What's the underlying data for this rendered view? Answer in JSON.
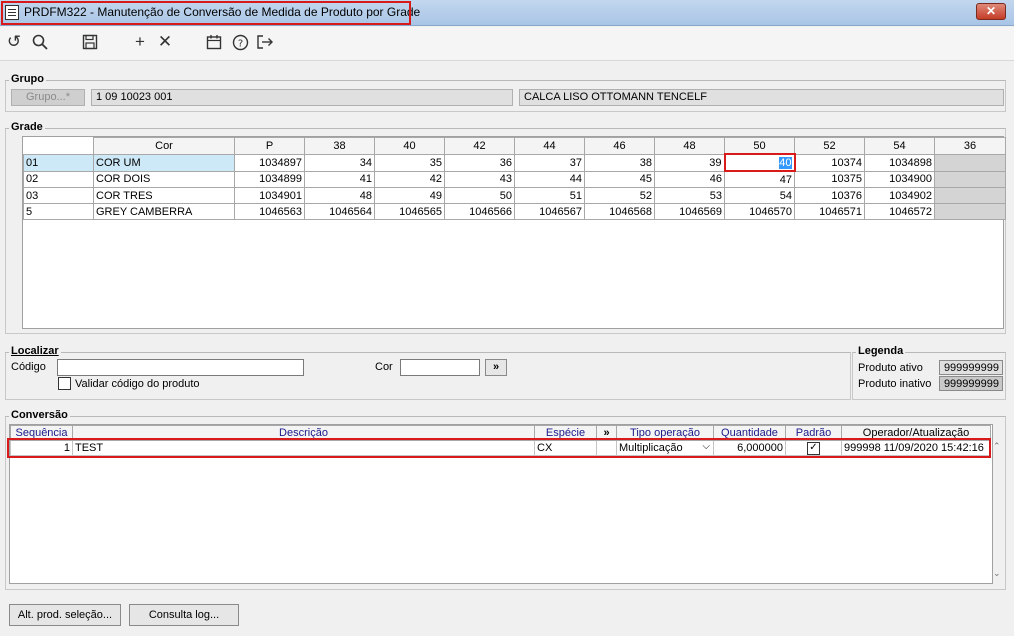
{
  "window": {
    "title": "PRDFM322 - Manutenção de Conversão de Medida de Produto por Grade",
    "close_label": "✕"
  },
  "toolbar": {
    "icons": [
      "undo-icon",
      "search-icon",
      "save-icon",
      "add-icon",
      "delete-icon",
      "calendar-icon",
      "help-icon",
      "exit-icon"
    ]
  },
  "grupo": {
    "title": "Grupo",
    "button_label": "Grupo...*",
    "code": "1 09 10023 001",
    "description": "CALCA LISO OTTOMANN TENCELF"
  },
  "grade": {
    "title": "Grade",
    "headers": [
      "",
      "Cor",
      "P",
      "38",
      "40",
      "42",
      "44",
      "46",
      "48",
      "50",
      "52",
      "54",
      "36"
    ],
    "rows": [
      [
        "01",
        "COR UM",
        "1034897",
        "34",
        "35",
        "36",
        "37",
        "38",
        "39",
        "40",
        "10374",
        "1034898",
        ""
      ],
      [
        "02",
        "COR DOIS",
        "1034899",
        "41",
        "42",
        "43",
        "44",
        "45",
        "46",
        "47",
        "10375",
        "1034900",
        ""
      ],
      [
        "03",
        "COR TRES",
        "1034901",
        "48",
        "49",
        "50",
        "51",
        "52",
        "53",
        "54",
        "10376",
        "1034902",
        ""
      ],
      [
        "5",
        "GREY CAMBERRA",
        "1046563",
        "1046564",
        "1046565",
        "1046566",
        "1046567",
        "1046568",
        "1046569",
        "1046570",
        "1046571",
        "1046572",
        ""
      ]
    ]
  },
  "localizar": {
    "title": "Localizar",
    "codigo_label": "Código",
    "codigo_value": "",
    "cor_label": "Cor",
    "cor_value": "",
    "go_label": "»",
    "validar_label": "Validar código do produto"
  },
  "legenda": {
    "title": "Legenda",
    "ativo_label": "Produto ativo",
    "ativo_value": "999999999",
    "inativo_label": "Produto inativo",
    "inativo_value": "999999999"
  },
  "conversao": {
    "title": "Conversão",
    "headers": [
      "Sequência",
      "Descrição",
      "Espécie",
      "»",
      "Tipo operação",
      "Quantidade",
      "Padrão",
      "Operador/Atualização"
    ],
    "rows": [
      {
        "seq": "1",
        "descricao": "TEST",
        "especie": "CX",
        "tipo": "Multiplicação",
        "quantidade": "6,000000",
        "padrao": "✓",
        "operador": "999998 11/09/2020 15:42:16"
      }
    ]
  },
  "footer": {
    "alt_label": "Alt. prod. seleção...",
    "log_label": "Consulta log..."
  }
}
